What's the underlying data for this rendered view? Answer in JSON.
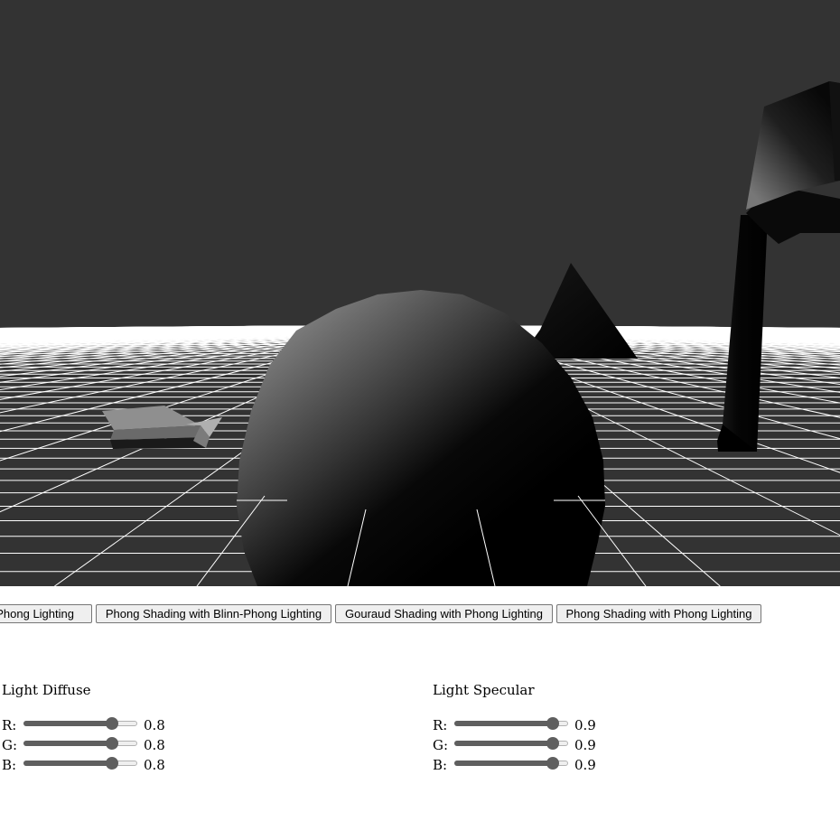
{
  "scene": {
    "background_color": "#333333",
    "grid_color": "#ffffff"
  },
  "buttons": [
    {
      "label": "Blinn-Phong Lighting",
      "name": "button-gouraud-blinn-phong"
    },
    {
      "label": "Phong Shading with Blinn-Phong Lighting",
      "name": "button-phong-blinn-phong"
    },
    {
      "label": "Gouraud Shading with Phong Lighting",
      "name": "button-gouraud-phong"
    },
    {
      "label": "Phong Shading with Phong Lighting",
      "name": "button-phong-phong"
    }
  ],
  "light_diffuse": {
    "title": "Light Diffuse",
    "channels": [
      {
        "label": "R:",
        "value": "0.8",
        "level": 0.8
      },
      {
        "label": "G:",
        "value": "0.8",
        "level": 0.8
      },
      {
        "label": "B:",
        "value": "0.8",
        "level": 0.8
      }
    ]
  },
  "light_specular": {
    "title": "Light Specular",
    "channels": [
      {
        "label": "R:",
        "value": "0.9",
        "level": 0.9
      },
      {
        "label": "G:",
        "value": "0.9",
        "level": 0.9
      },
      {
        "label": "B:",
        "value": "0.9",
        "level": 0.9
      }
    ]
  }
}
